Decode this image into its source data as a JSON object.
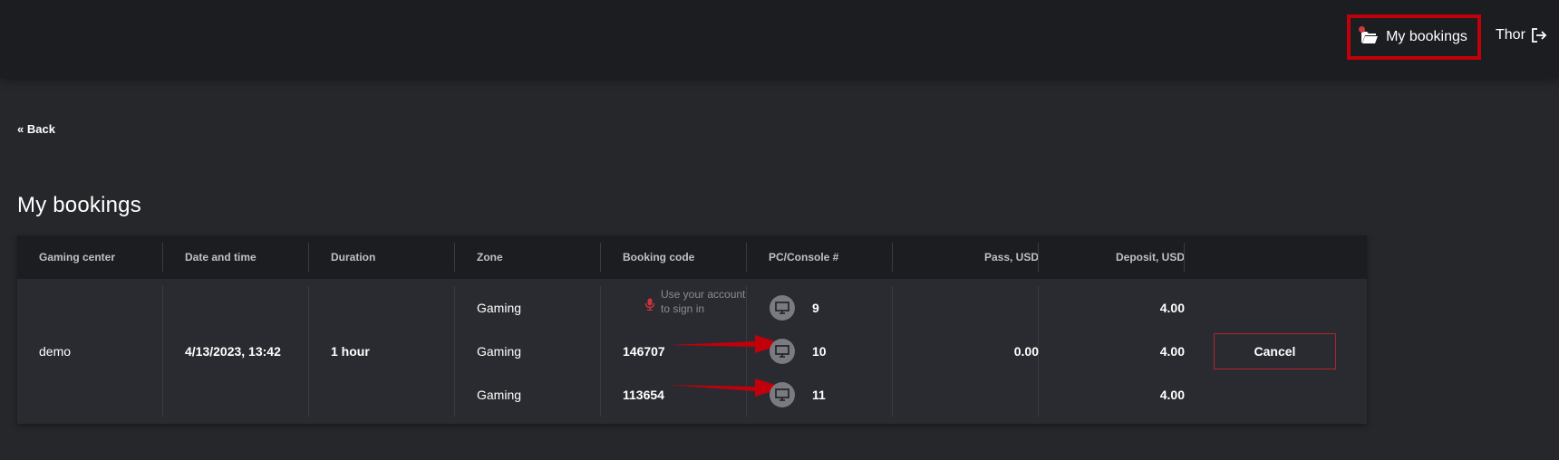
{
  "header": {
    "my_bookings_label": "My bookings",
    "user_name": "Thor"
  },
  "nav": {
    "back_label": "« Back"
  },
  "page": {
    "title": "My bookings"
  },
  "table": {
    "columns": [
      "Gaming center",
      "Date and time",
      "Duration",
      "Zone",
      "Booking code",
      "PC/Console #",
      "Pass, USD",
      "Deposit, USD"
    ],
    "booking": {
      "gaming_center": "demo",
      "date_time": "4/13/2023, 13:42",
      "duration": "1 hour",
      "pass_usd": "0.00",
      "cancel_label": "Cancel",
      "rows": [
        {
          "zone": "Gaming",
          "booking_code": "",
          "booking_code_hint": "Use your account to sign in",
          "pc": "9",
          "deposit": "4.00"
        },
        {
          "zone": "Gaming",
          "booking_code": "146707",
          "pc": "10",
          "deposit": "4.00"
        },
        {
          "zone": "Gaming",
          "booking_code": "113654",
          "pc": "11",
          "deposit": "4.00"
        }
      ]
    }
  },
  "colors": {
    "highlight": "#c0000b",
    "accent_red": "#d0393e",
    "header_bg": "#1c1d21",
    "page_bg": "#26272b"
  },
  "icons": {
    "nav": "folder-open-icon",
    "logout": "sign-out-icon",
    "hint": "microphone-icon",
    "pc": "monitor-icon"
  }
}
